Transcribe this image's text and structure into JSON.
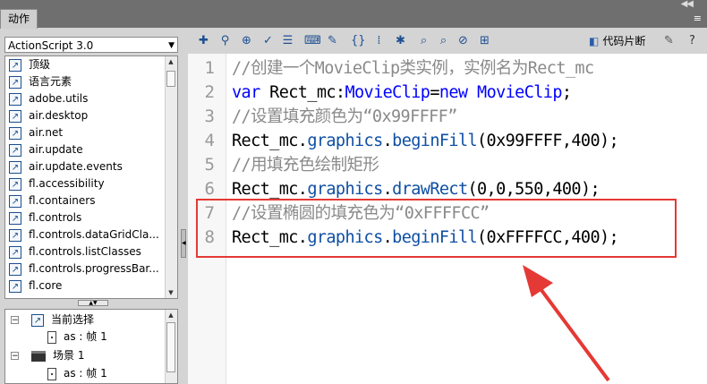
{
  "panel": {
    "tab_label": "动作"
  },
  "language_select": {
    "value": "ActionScript 3.0"
  },
  "library": {
    "items": [
      "顶级",
      "语言元素",
      "adobe.utils",
      "air.desktop",
      "air.net",
      "air.update",
      "air.update.events",
      "fl.accessibility",
      "fl.containers",
      "fl.controls",
      "fl.controls.dataGridCla...",
      "fl.controls.listClasses",
      "fl.controls.progressBar...",
      "fl.core"
    ]
  },
  "script_tree": {
    "current_selection": "当前选择",
    "current_script": "as : 帧 1",
    "scene": "场景 1",
    "scene_script": "as : 帧 1"
  },
  "toolbar": {
    "code_snippets_label": "代码片断"
  },
  "editor": {
    "line_numbers": [
      "1",
      "2",
      "3",
      "4",
      "5",
      "6",
      "7",
      "8"
    ],
    "lines": [
      [
        {
          "t": "//创建一个MovieClip类实例，实例名为Rect_mc",
          "c": "cm"
        }
      ],
      [
        {
          "t": "var",
          "c": "kw"
        },
        {
          "t": " Rect_mc:",
          "c": ""
        },
        {
          "t": "MovieClip",
          "c": "ty"
        },
        {
          "t": "=",
          "c": ""
        },
        {
          "t": "new",
          "c": "kw"
        },
        {
          "t": " ",
          "c": ""
        },
        {
          "t": "MovieClip",
          "c": "ty"
        },
        {
          "t": ";",
          "c": ""
        }
      ],
      [
        {
          "t": "//设置填充颜色为“0x99FFFF”",
          "c": "cm"
        }
      ],
      [
        {
          "t": "Rect_mc.",
          "c": ""
        },
        {
          "t": "graphics",
          "c": "mt"
        },
        {
          "t": ".",
          "c": ""
        },
        {
          "t": "beginFill",
          "c": "mt"
        },
        {
          "t": "(0x99FFFF,400);",
          "c": ""
        }
      ],
      [
        {
          "t": "//用填充色绘制矩形",
          "c": "cm"
        }
      ],
      [
        {
          "t": "Rect_mc.",
          "c": ""
        },
        {
          "t": "graphics",
          "c": "mt"
        },
        {
          "t": ".",
          "c": ""
        },
        {
          "t": "drawRect",
          "c": "mt"
        },
        {
          "t": "(0,0,550,400);",
          "c": ""
        }
      ],
      [
        {
          "t": "//设置椭圆的填充色为“0xFFFFCC”",
          "c": "cm"
        }
      ],
      [
        {
          "t": "Rect_mc.",
          "c": ""
        },
        {
          "t": "graphics",
          "c": "mt"
        },
        {
          "t": ".",
          "c": ""
        },
        {
          "t": "beginFill",
          "c": "mt"
        },
        {
          "t": "(0xFFFFCC,400);",
          "c": ""
        }
      ]
    ]
  },
  "annotation": {
    "color": "#e53935"
  }
}
